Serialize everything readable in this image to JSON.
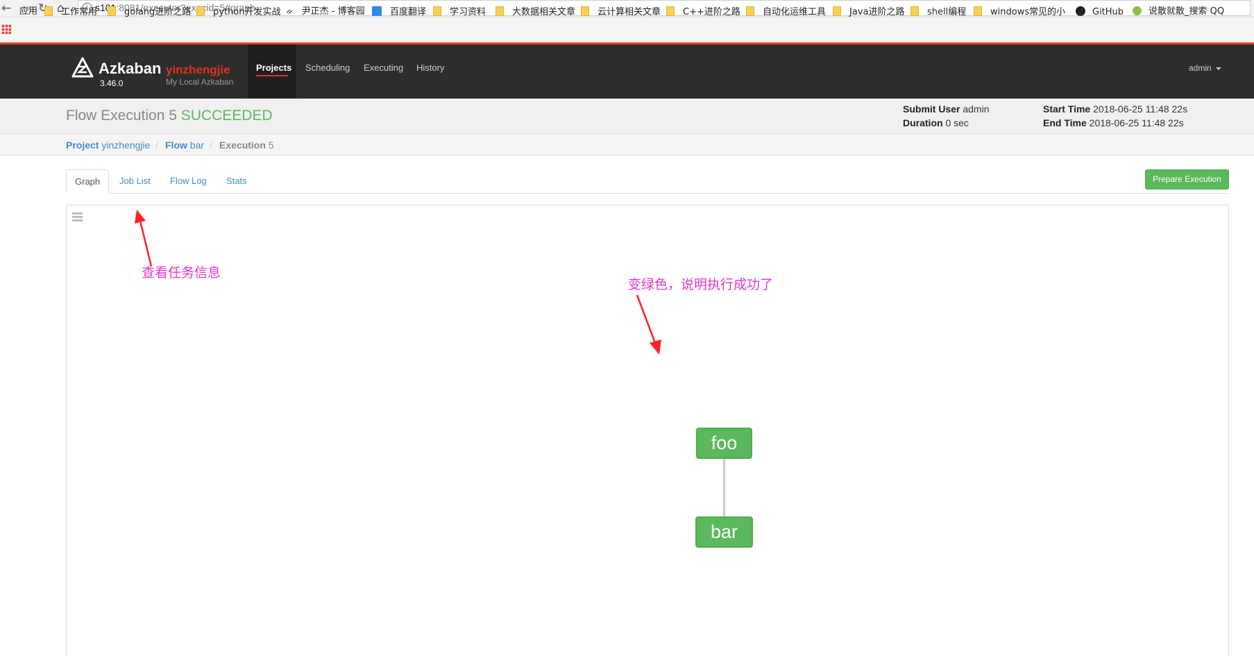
{
  "browser": {
    "url_host": "s101",
    "url_rest": ":8081/executor?execid=5#graph",
    "bookmarks": [
      "应用",
      "工作常用",
      "golang进阶之路",
      "python开发实战",
      "尹正杰 - 博客园",
      "百度翻译",
      "学习资料",
      "大数据相关文章",
      "云计算相关文章",
      "C++进阶之路",
      "自动化运维工具",
      "Java进阶之路",
      "shell编程",
      "windows常见的小",
      "GitHub",
      "说散就散_搜索 QQ"
    ]
  },
  "navbar": {
    "brand": "Azkaban",
    "brand_sub": "yinzhengjie",
    "version": "3.46.0",
    "env_desc": "My Local Azkaban",
    "links": [
      "Projects",
      "Scheduling",
      "Executing",
      "History"
    ],
    "user": "admin"
  },
  "header": {
    "title": "Flow Execution 5",
    "status": "SUCCEEDED",
    "status_color": "#5cb85c",
    "submit_user_label": "Submit User",
    "submit_user": "admin",
    "duration_label": "Duration",
    "duration": "0 sec",
    "start_time_label": "Start Time",
    "start_time": "2018-06-25 11:48 22s",
    "end_time_label": "End Time",
    "end_time": "2018-06-25 11:48 22s"
  },
  "breadcrumb": {
    "project_label": "Project",
    "project": "yinzhengjie",
    "flow_label": "Flow",
    "flow": "bar",
    "execution_label": "Execution",
    "execution": "5"
  },
  "tabs": [
    "Graph",
    "Job List",
    "Flow Log",
    "Stats"
  ],
  "prepare_button": "Prepare Execution",
  "graph": {
    "nodes": [
      "foo",
      "bar"
    ],
    "node_color": "#5cb85c"
  },
  "annotations": {
    "job_list_note": "查看任务信息",
    "success_note": "变绿色，说明执行成功了"
  }
}
